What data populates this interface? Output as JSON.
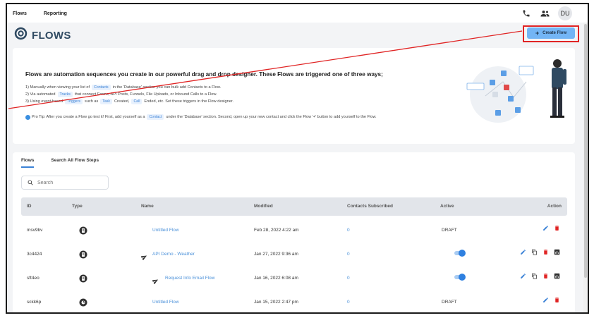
{
  "nav": {
    "items": [
      "Flows",
      "Reporting"
    ],
    "avatar": "DU"
  },
  "header": {
    "title": "FLOWS",
    "create_label": "Create Flow",
    "create_plus": "+"
  },
  "info": {
    "headline": "Flows are automation sequences you create in our powerful drag and drop designer. These Flows are triggered one of three ways;",
    "l1_a": "1) Manually when viewing your list of",
    "l1_chip": "Contacts",
    "l1_b": "in the 'Database' section you can bulk add Contacts to a Flow.",
    "l2_a": "2) Via automated",
    "l2_chip": "Tracks",
    "l2_b": "that connect Forms, API Posts, Funnels, File Uploads, or Inbound Calls to a Flow.",
    "l3_a": "3) Using event-based",
    "l3_chip1": "Triggers",
    "l3_b": "such as",
    "l3_chip2": "Task",
    "l3_c": "Created,",
    "l3_chip3": "Call",
    "l3_d": "Ended, etc. Set these triggers in the Flow designer.",
    "tip_a": "Pro Tip: After you create a Flow go test it! First, add yourself as a",
    "tip_chip": "Contact",
    "tip_b": "under the 'Database' section. Second, open up your new contact and click the Flow '+' button to add yourself to the Flow."
  },
  "flows": {
    "tabs": [
      "Flows",
      "Search All Flow Steps"
    ],
    "search_placeholder": "Search",
    "columns": {
      "id": "ID",
      "type": "Type",
      "name": "Name",
      "modified": "Modified",
      "contacts": "Contacts Subscribed",
      "active": "Active",
      "action": "Action"
    },
    "rows": [
      {
        "id": "msv9bv",
        "name": "Untitled Flow",
        "modified": "Feb 28, 2022 4:22 am",
        "contacts": "0",
        "active": "DRAFT"
      },
      {
        "id": "3c4424",
        "name": "API Demo - Weather",
        "modified": "Jan 27, 2022 9:36 am",
        "contacts": "0",
        "active": ""
      },
      {
        "id": "sft4eo",
        "name": "Request Info Email Flow",
        "modified": "Jan 16, 2022 6:08 am",
        "contacts": "0",
        "active": ""
      },
      {
        "id": "sckk6p",
        "name": "Untitled Flow",
        "modified": "Jan 15, 2022 2:47 pm",
        "contacts": "0",
        "active": "DRAFT"
      }
    ]
  },
  "colors": {
    "accent": "#3b82d6",
    "title": "#2f4a62",
    "create_button": "#73b5f5",
    "annotation": "#e02424",
    "delete": "#e02424"
  },
  "icons": {
    "phone": "phone-icon",
    "users": "users-icon",
    "flows_logo": "flows-gear-icon",
    "search": "search-icon",
    "send": "send-icon",
    "edit": "edit-icon",
    "copy": "copy-icon",
    "delete": "delete-icon",
    "report": "report-icon"
  }
}
